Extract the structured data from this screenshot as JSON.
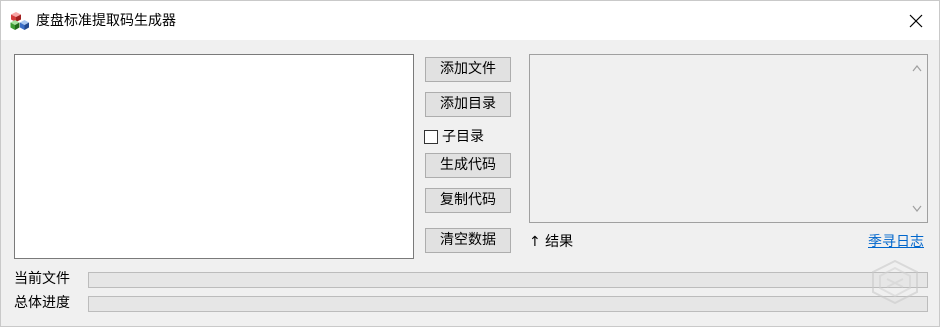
{
  "window": {
    "title": "度盘标准提取码生成器",
    "icon": "app-cubes-icon",
    "close_icon": "close-icon"
  },
  "buttons": {
    "add_file": "添加文件",
    "add_dir": "添加目录",
    "generate_code": "生成代码",
    "copy_code": "复制代码",
    "clear_data": "清空数据"
  },
  "subdir_checkbox": {
    "label": "子目录",
    "checked": false
  },
  "result": {
    "label": "↑ 结果",
    "text": ""
  },
  "link": {
    "label": "季寻日志"
  },
  "progress": {
    "current_label": "当前文件",
    "total_label": "总体进度",
    "current_value": 0,
    "total_value": 0
  },
  "colors": {
    "link": "#0066cc",
    "progress_fill": "#06b025"
  }
}
